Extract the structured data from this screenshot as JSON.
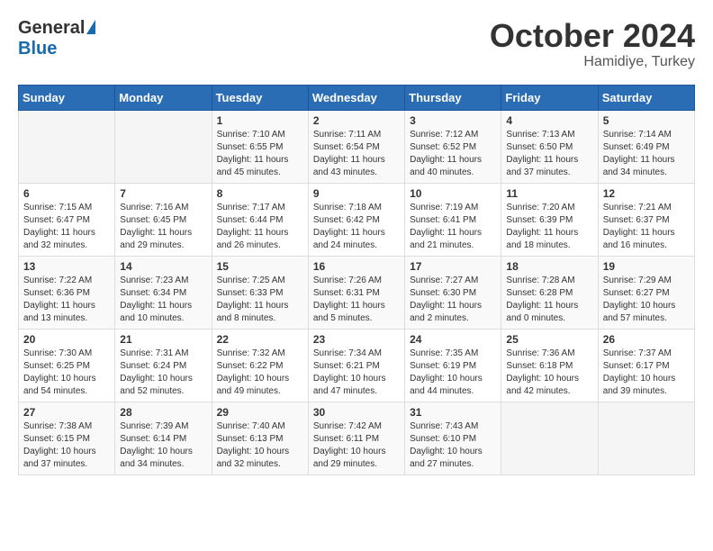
{
  "logo": {
    "general": "General",
    "blue": "Blue"
  },
  "header": {
    "month": "October 2024",
    "location": "Hamidiye, Turkey"
  },
  "days_of_week": [
    "Sunday",
    "Monday",
    "Tuesday",
    "Wednesday",
    "Thursday",
    "Friday",
    "Saturday"
  ],
  "weeks": [
    [
      {
        "day": "",
        "info": ""
      },
      {
        "day": "",
        "info": ""
      },
      {
        "day": "1",
        "info": "Sunrise: 7:10 AM\nSunset: 6:55 PM\nDaylight: 11 hours and 45 minutes."
      },
      {
        "day": "2",
        "info": "Sunrise: 7:11 AM\nSunset: 6:54 PM\nDaylight: 11 hours and 43 minutes."
      },
      {
        "day": "3",
        "info": "Sunrise: 7:12 AM\nSunset: 6:52 PM\nDaylight: 11 hours and 40 minutes."
      },
      {
        "day": "4",
        "info": "Sunrise: 7:13 AM\nSunset: 6:50 PM\nDaylight: 11 hours and 37 minutes."
      },
      {
        "day": "5",
        "info": "Sunrise: 7:14 AM\nSunset: 6:49 PM\nDaylight: 11 hours and 34 minutes."
      }
    ],
    [
      {
        "day": "6",
        "info": "Sunrise: 7:15 AM\nSunset: 6:47 PM\nDaylight: 11 hours and 32 minutes."
      },
      {
        "day": "7",
        "info": "Sunrise: 7:16 AM\nSunset: 6:45 PM\nDaylight: 11 hours and 29 minutes."
      },
      {
        "day": "8",
        "info": "Sunrise: 7:17 AM\nSunset: 6:44 PM\nDaylight: 11 hours and 26 minutes."
      },
      {
        "day": "9",
        "info": "Sunrise: 7:18 AM\nSunset: 6:42 PM\nDaylight: 11 hours and 24 minutes."
      },
      {
        "day": "10",
        "info": "Sunrise: 7:19 AM\nSunset: 6:41 PM\nDaylight: 11 hours and 21 minutes."
      },
      {
        "day": "11",
        "info": "Sunrise: 7:20 AM\nSunset: 6:39 PM\nDaylight: 11 hours and 18 minutes."
      },
      {
        "day": "12",
        "info": "Sunrise: 7:21 AM\nSunset: 6:37 PM\nDaylight: 11 hours and 16 minutes."
      }
    ],
    [
      {
        "day": "13",
        "info": "Sunrise: 7:22 AM\nSunset: 6:36 PM\nDaylight: 11 hours and 13 minutes."
      },
      {
        "day": "14",
        "info": "Sunrise: 7:23 AM\nSunset: 6:34 PM\nDaylight: 11 hours and 10 minutes."
      },
      {
        "day": "15",
        "info": "Sunrise: 7:25 AM\nSunset: 6:33 PM\nDaylight: 11 hours and 8 minutes."
      },
      {
        "day": "16",
        "info": "Sunrise: 7:26 AM\nSunset: 6:31 PM\nDaylight: 11 hours and 5 minutes."
      },
      {
        "day": "17",
        "info": "Sunrise: 7:27 AM\nSunset: 6:30 PM\nDaylight: 11 hours and 2 minutes."
      },
      {
        "day": "18",
        "info": "Sunrise: 7:28 AM\nSunset: 6:28 PM\nDaylight: 11 hours and 0 minutes."
      },
      {
        "day": "19",
        "info": "Sunrise: 7:29 AM\nSunset: 6:27 PM\nDaylight: 10 hours and 57 minutes."
      }
    ],
    [
      {
        "day": "20",
        "info": "Sunrise: 7:30 AM\nSunset: 6:25 PM\nDaylight: 10 hours and 54 minutes."
      },
      {
        "day": "21",
        "info": "Sunrise: 7:31 AM\nSunset: 6:24 PM\nDaylight: 10 hours and 52 minutes."
      },
      {
        "day": "22",
        "info": "Sunrise: 7:32 AM\nSunset: 6:22 PM\nDaylight: 10 hours and 49 minutes."
      },
      {
        "day": "23",
        "info": "Sunrise: 7:34 AM\nSunset: 6:21 PM\nDaylight: 10 hours and 47 minutes."
      },
      {
        "day": "24",
        "info": "Sunrise: 7:35 AM\nSunset: 6:19 PM\nDaylight: 10 hours and 44 minutes."
      },
      {
        "day": "25",
        "info": "Sunrise: 7:36 AM\nSunset: 6:18 PM\nDaylight: 10 hours and 42 minutes."
      },
      {
        "day": "26",
        "info": "Sunrise: 7:37 AM\nSunset: 6:17 PM\nDaylight: 10 hours and 39 minutes."
      }
    ],
    [
      {
        "day": "27",
        "info": "Sunrise: 7:38 AM\nSunset: 6:15 PM\nDaylight: 10 hours and 37 minutes."
      },
      {
        "day": "28",
        "info": "Sunrise: 7:39 AM\nSunset: 6:14 PM\nDaylight: 10 hours and 34 minutes."
      },
      {
        "day": "29",
        "info": "Sunrise: 7:40 AM\nSunset: 6:13 PM\nDaylight: 10 hours and 32 minutes."
      },
      {
        "day": "30",
        "info": "Sunrise: 7:42 AM\nSunset: 6:11 PM\nDaylight: 10 hours and 29 minutes."
      },
      {
        "day": "31",
        "info": "Sunrise: 7:43 AM\nSunset: 6:10 PM\nDaylight: 10 hours and 27 minutes."
      },
      {
        "day": "",
        "info": ""
      },
      {
        "day": "",
        "info": ""
      }
    ]
  ]
}
